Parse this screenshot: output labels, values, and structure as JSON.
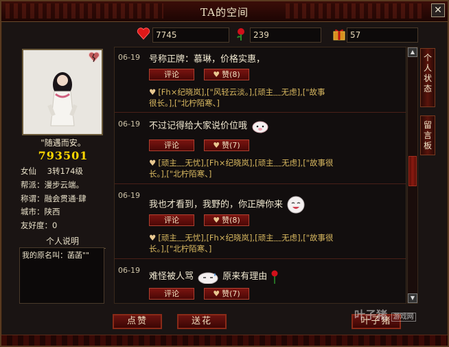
{
  "window": {
    "title": "TA的空间",
    "close_label": "✕"
  },
  "stats": {
    "hearts": {
      "value": "7745",
      "icon": "heart-icon"
    },
    "flowers": {
      "value": "239",
      "icon": "rose-icon"
    },
    "gifts": {
      "value": "57",
      "icon": "gift-icon"
    }
  },
  "profile": {
    "motto": "\"随遇而安。",
    "score": "793501",
    "class_label": "女仙",
    "level": "3转174级",
    "guild": "帮派：漫步云端。",
    "title": "称谓：融会贯通·肆",
    "city": "城市：陕西",
    "friendship": "友好度：0",
    "desc_header": "个人说明",
    "desc_text": "我的原名叫：菡菡\"\""
  },
  "feed": [
    {
      "date": "06-19",
      "text": "号称正牌：慕琳，价格实惠，",
      "comment_label": "评论",
      "like_label": "赞(8)",
      "likers_1": "[Fh×纪晓岚],[\"风轻云淡。],[顽主﹏无虑],[\"故事",
      "likers_2": "很长。],[\"北柠陌寒、]"
    },
    {
      "date": "06-19",
      "text": "不过记得给大家说价位哦",
      "comment_label": "评论",
      "like_label": "赞(7)",
      "likers_1": "[顽主﹏无忧],[Fh×纪晓岚],[顽主﹏无虑],[\"故事很",
      "likers_2": "长。],[\"北柠陌寒、]"
    },
    {
      "date": "06-19",
      "text": "我也才看到，我野的，你正牌你来",
      "comment_label": "评论",
      "like_label": "赞(8)",
      "likers_1": "[顽主﹏无忧],[Fh×纪晓岚],[顽主﹏无虑],[\"故事很",
      "likers_2": "长。],[\"北柠陌寒、]"
    },
    {
      "date": "06-19",
      "text": "难怪被人骂",
      "text_after": "原来有理由",
      "comment_label": "评论",
      "like_label": "赞(7)"
    }
  ],
  "tabs": {
    "personal_status": "个人状态",
    "message_board": "留言板"
  },
  "buttons": {
    "like": "点赞",
    "send_flower": "送花",
    "interact": "叶子猪"
  },
  "watermark": {
    "brand": "叶子猪",
    "sub": "游戏网"
  },
  "colors": {
    "accent": "#7a1410",
    "gold": "#ffd700",
    "liker_text": "#d8b860"
  }
}
